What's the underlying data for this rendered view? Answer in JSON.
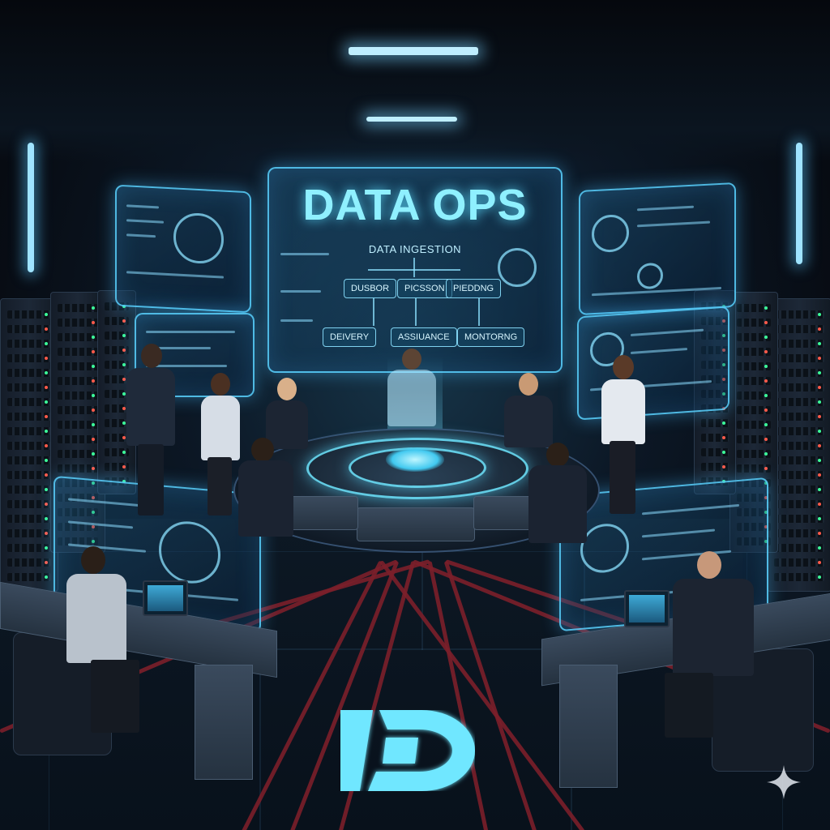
{
  "scene": {
    "description_tags": [
      "data-center",
      "holographic-displays",
      "operators",
      "round-console"
    ]
  },
  "main_display": {
    "title": "DATA OPS",
    "subtitle": "DATA INGESTION",
    "nodes_top": [
      "DUSBOR",
      "PICSSON",
      "PIEDDNG"
    ],
    "nodes_bottom": [
      "DEIVERY",
      "ASSIUANCE",
      "MONTORNG"
    ]
  },
  "colors": {
    "accent": "#8ff0ff",
    "cable": "#7b1f2a",
    "background": "#070b12"
  },
  "logo": {
    "icon": "data-ops-d-logo"
  },
  "watermark": {
    "icon": "sparkle-icon"
  }
}
